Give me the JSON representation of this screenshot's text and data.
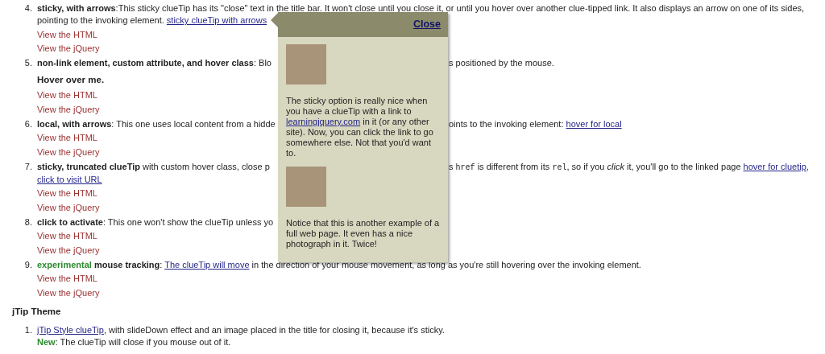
{
  "items": [
    {
      "number": "4.",
      "lines": [
        {
          "before": [
            {
              "kind": "text",
              "text": "**sticky, with arrows**:This sticky clueTip has its \"close\" text in the title bar. It won't close until you close it, or until you hover over another clue-tipped link. It also displays an arrow on one of its sides,"
            }
          ]
        },
        {
          "before": [
            {
              "kind": "text",
              "text": "pointing to the invoking element."
            },
            {
              "kind": "link",
              "text": "sticky clueTip with arrows"
            }
          ]
        }
      ],
      "links": [
        "View the HTML",
        "View the jQuery"
      ]
    },
    {
      "number": "5.",
      "lines": [
        {
          "before": [
            {
              "kind": "text",
              "text": "**non-link element, custom attribute, and hover class**: Blo"
            }
          ],
          "after": [
            {
              "kind": "text",
              "text": "s positioned by the mouse."
            }
          ]
        }
      ],
      "hover_label": "Hover over me.",
      "links": [
        "View the HTML",
        "View the jQuery"
      ]
    },
    {
      "number": "6.",
      "lines": [
        {
          "before": [
            {
              "kind": "text",
              "text": "**local, with arrows**: This one uses local content from a hidde"
            }
          ],
          "after": [
            {
              "kind": "text",
              "text": "oints to the invoking element:"
            },
            {
              "kind": "link",
              "text": "hover for local"
            }
          ]
        }
      ],
      "links": [
        "View the HTML",
        "View the jQuery"
      ]
    },
    {
      "number": "7.",
      "lines": [
        {
          "before": [
            {
              "kind": "text",
              "text": "**sticky, truncated clueTip** with custom hover class, close p"
            }
          ],
          "after": [
            {
              "kind": "text",
              "text": "s"
            },
            {
              "kind": "code",
              "text": "href"
            },
            {
              "kind": "text",
              "text": "is different from its"
            },
            {
              "kind": "code",
              "text": "rel"
            },
            {
              "kind": "text",
              "text": ", so if you *click* it, you'll go to the linked page"
            },
            {
              "kind": "link",
              "text": "hover for cluetip,"
            }
          ]
        },
        {
          "before": [
            {
              "kind": "link",
              "text": "click to visit URL"
            }
          ]
        }
      ],
      "links": [
        "View the HTML",
        "View the jQuery"
      ]
    },
    {
      "number": "8.",
      "lines": [
        {
          "before": [
            {
              "kind": "text",
              "text": "**click to activate**: This one won't show the clueTip unless yo"
            }
          ]
        }
      ],
      "links": [
        "View the HTML",
        "View the jQuery"
      ]
    },
    {
      "number": "9.",
      "lines": [
        {
          "before": [
            {
              "kind": "green",
              "text": "experimental"
            },
            {
              "kind": "text",
              "text": "**mouse tracking**:"
            },
            {
              "kind": "link",
              "text": "The clueTip will move"
            },
            {
              "kind": "text",
              "text": "in the direction of your mouse movement, as long as you're still hovering over the invoking element."
            }
          ]
        }
      ],
      "links": [
        "View the HTML",
        "View the jQuery"
      ]
    }
  ],
  "section_title": "jTip Theme",
  "section_items": [
    {
      "number": "1.",
      "lines": [
        {
          "before": [
            {
              "kind": "link",
              "text": "jTip Style clueTip"
            },
            {
              "kind": "text",
              "text": ", with slideDown effect and an image placed in the title for closing it, because it's sticky."
            }
          ]
        },
        {
          "before": [
            {
              "kind": "green",
              "text": "New"
            },
            {
              "kind": "text",
              "text": ": The clueTip will close if you mouse out of it."
            }
          ]
        }
      ]
    }
  ],
  "tooltip": {
    "close": "Close",
    "blocks": [
      {
        "kind": "image"
      },
      {
        "kind": "paragraph",
        "segments": [
          {
            "kind": "text",
            "text": "The sticky option is really nice when you have a clueTip with a link to"
          },
          {
            "kind": "link",
            "text": "learningjquery.com"
          },
          {
            "kind": "text",
            "text": "in it (or any other site). Now, you can click the link to go somewhere else. Not that you'd want to."
          }
        ]
      },
      {
        "kind": "image"
      },
      {
        "kind": "paragraph",
        "segments": [
          {
            "kind": "text",
            "text": "Notice that this is another example of a full web page. It even has a nice photograph in it. Twice!"
          }
        ]
      }
    ]
  }
}
